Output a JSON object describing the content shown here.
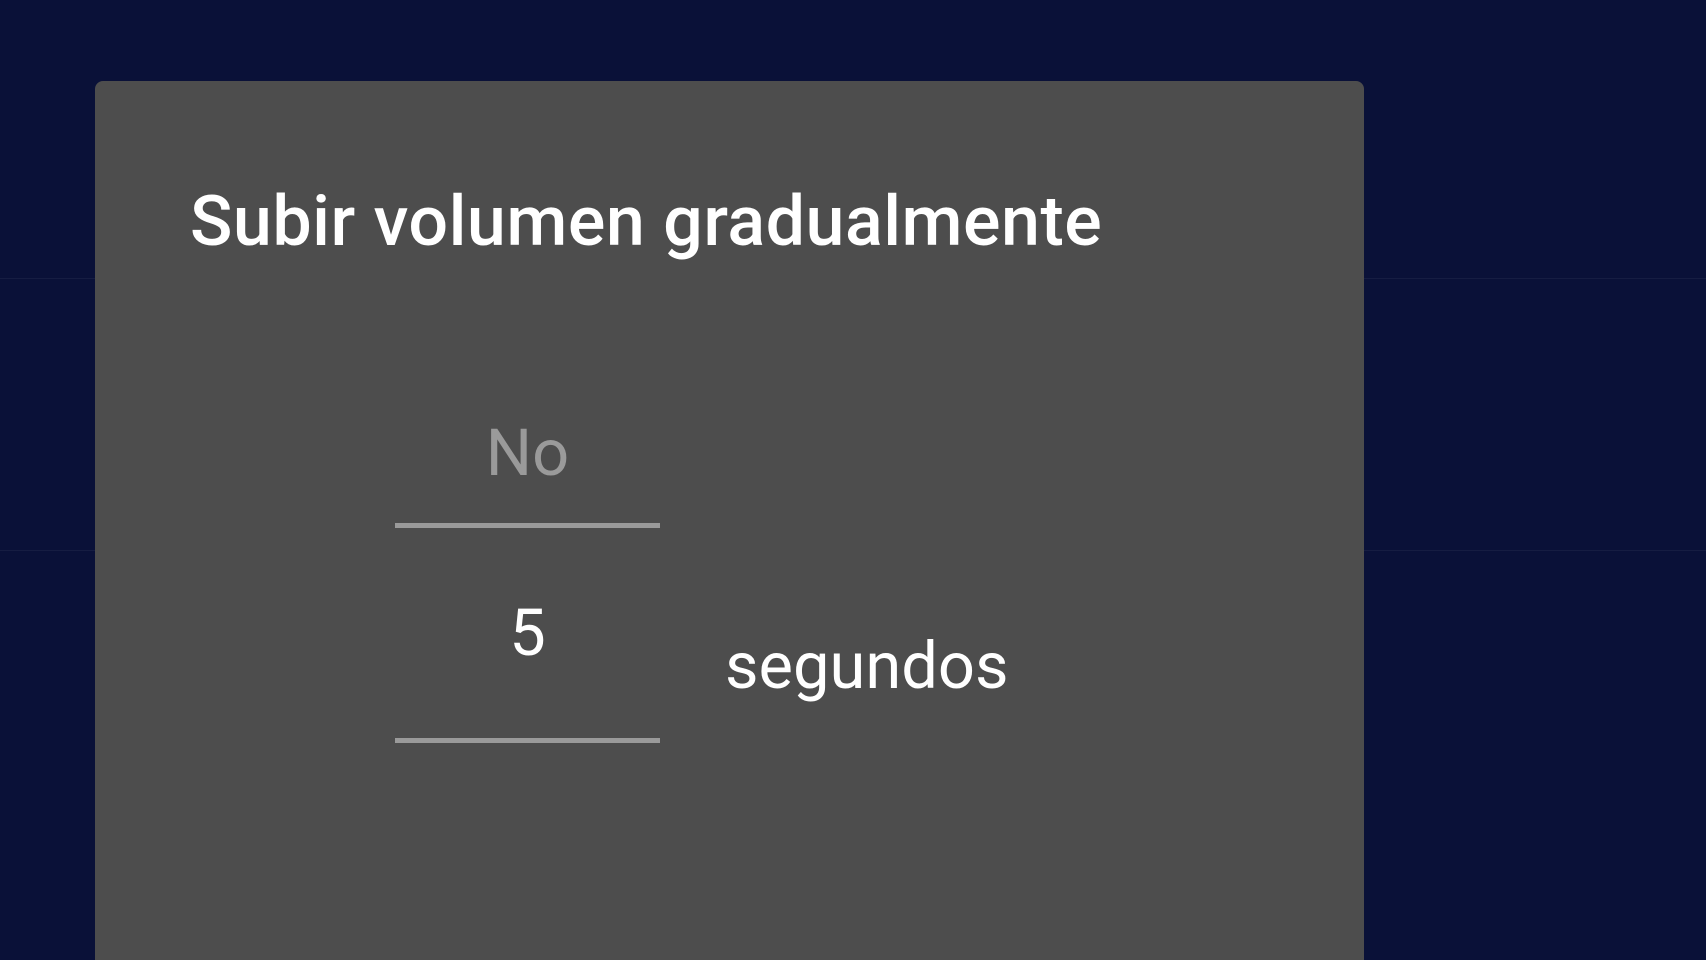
{
  "dialog": {
    "title": "Subir volumen gradualmente",
    "picker": {
      "previous_option": "No",
      "selected_value": "5",
      "unit_label": "segundos"
    }
  }
}
